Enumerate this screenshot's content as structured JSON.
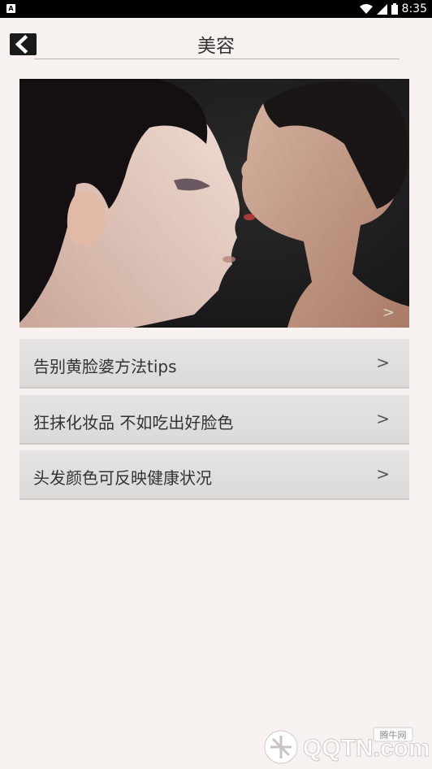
{
  "status_bar": {
    "left_icon": "A",
    "time": "8:35",
    "icons": [
      "wifi-icon",
      "signal-icon",
      "battery-icon"
    ]
  },
  "header": {
    "title": "美容",
    "back_icon": "back-arrow-icon"
  },
  "hero": {
    "image": "two-women-profile-photo",
    "chevron": ">"
  },
  "articles": [
    {
      "title": "告别黄脸婆方法tips",
      "chevron": ">"
    },
    {
      "title": "狂抹化妆品 不如吃出好脸色",
      "chevron": ">"
    },
    {
      "title": "头发颜色可反映健康状况",
      "chevron": ">"
    }
  ],
  "watermark": {
    "logo": "QQTN.com",
    "label": "腾牛网"
  },
  "colors": {
    "background": "#f7f2ef",
    "status_bar": "#000000",
    "list_item": "#e2e0de"
  }
}
